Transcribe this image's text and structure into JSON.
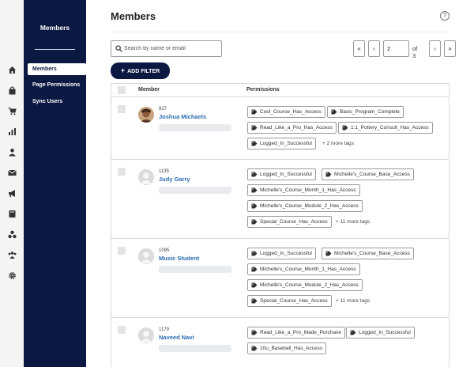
{
  "sidebar": {
    "title": "Members",
    "items": [
      {
        "label": "Members",
        "active": true
      },
      {
        "label": "Page Permissions",
        "active": false
      },
      {
        "label": "Sync Users",
        "active": false
      }
    ]
  },
  "rail_icons": [
    "home-icon",
    "bag-icon",
    "cart-icon",
    "chart-icon",
    "user-icon",
    "mail-icon",
    "megaphone-icon",
    "book-icon",
    "group-icon",
    "people-icon",
    "gear-icon"
  ],
  "header": {
    "title": "Members",
    "help": "?"
  },
  "search": {
    "placeholder": "Search by name or email",
    "value": ""
  },
  "pagination": {
    "first": "«",
    "prev": "‹",
    "current": "2",
    "of_total": "of 3",
    "next": "›",
    "last": "»"
  },
  "filter": {
    "label": "ADD FILTER",
    "icon": "plus-icon"
  },
  "table": {
    "columns": [
      "Member",
      "Permissions"
    ],
    "rows": [
      {
        "id": "827",
        "name": "Joshua Michaels",
        "avatar": "photo",
        "tag_rows": [
          [
            "Cool_Course_Has_Access",
            "Basic_Program_Complete"
          ],
          [
            "Read_Like_a_Pro_Has_Access",
            "1:1_Pottery_Consult_Has_Access"
          ],
          [
            "Logged_In_Successful"
          ]
        ],
        "more": "+ 2 more tags"
      },
      {
        "id": "1135",
        "name": "Judy Garry",
        "avatar": "default",
        "tag_rows": [
          [
            "Logged_In_Successful",
            "Michelle's_Course_Base_Access"
          ],
          [
            "Michelle's_Course_Month_1_Has_Access"
          ],
          [
            "Michelle's_Course_Module_2_Has_Access"
          ],
          [
            "Special_Course_Has_Access"
          ]
        ],
        "more": "+ 11 more tags"
      },
      {
        "id": "1095",
        "name": "Music Student",
        "avatar": "default",
        "tag_rows": [
          [
            "Logged_In_Successful",
            "Michelle's_Course_Base_Access"
          ],
          [
            "Michelle's_Course_Month_1_Has_Access"
          ],
          [
            "Michelle's_Course_Module_2_Has_Access"
          ],
          [
            "Special_Course_Has_Access"
          ]
        ],
        "more": "+ 11 more tags"
      },
      {
        "id": "1179",
        "name": "Naveed Navi",
        "avatar": "default",
        "tag_rows": [
          [
            "Read_Like_a_Pro_Made_Purchase",
            "Logged_In_Successful"
          ],
          [
            "10u_Baseball_Has_Access"
          ]
        ],
        "more": ""
      }
    ]
  }
}
